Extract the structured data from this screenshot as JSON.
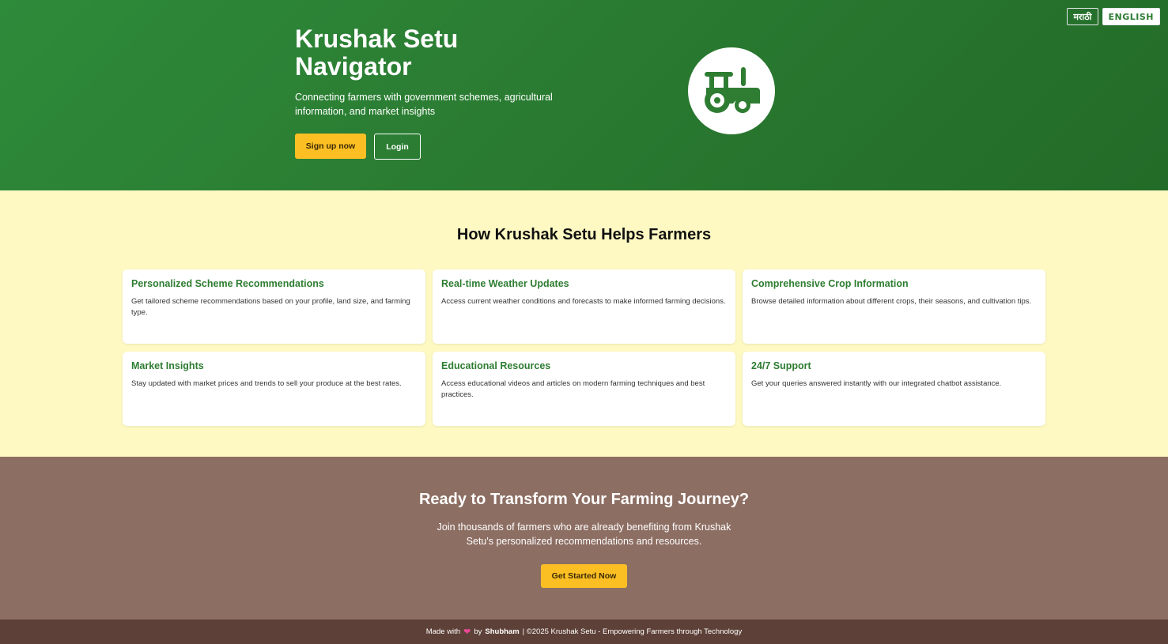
{
  "language_switch": {
    "marathi": "मराठी",
    "english": "ENGLISH"
  },
  "hero": {
    "title": "Krushak Setu Navigator",
    "subtitle": "Connecting farmers with government schemes, agricultural information, and market insights",
    "signup_label": "Sign up now",
    "login_label": "Login",
    "logo_icon": "tractor-icon"
  },
  "features": {
    "title": "How Krushak Setu Helps Farmers",
    "cards": [
      {
        "title": "Personalized Scheme Recommendations",
        "desc": "Get tailored scheme recommendations based on your profile, land size, and farming type."
      },
      {
        "title": "Real-time Weather Updates",
        "desc": "Access current weather conditions and forecasts to make informed farming decisions."
      },
      {
        "title": "Comprehensive Crop Information",
        "desc": "Browse detailed information about different crops, their seasons, and cultivation tips."
      },
      {
        "title": "Market Insights",
        "desc": "Stay updated with market prices and trends to sell your produce at the best rates."
      },
      {
        "title": "Educational Resources",
        "desc": "Access educational videos and articles on modern farming techniques and best practices."
      },
      {
        "title": "24/7 Support",
        "desc": "Get your queries answered instantly with our integrated chatbot assistance."
      }
    ]
  },
  "cta": {
    "title": "Ready to Transform Your Farming Journey?",
    "text": "Join thousands of farmers who are already benefiting from Krushak Setu's personalized recommendations and resources.",
    "button_label": "Get Started Now"
  },
  "footer": {
    "made_with": "Made with",
    "by": "by",
    "author": "Shubham",
    "rest": "| ©2025 Krushak Setu - Empowering Farmers through Technology"
  },
  "colors": {
    "primary_green": "#2e7d32",
    "accent_yellow": "#fbbf24",
    "features_bg": "#fef9c3",
    "cta_bg": "#8d6e63",
    "footer_bg": "#5d4037"
  }
}
